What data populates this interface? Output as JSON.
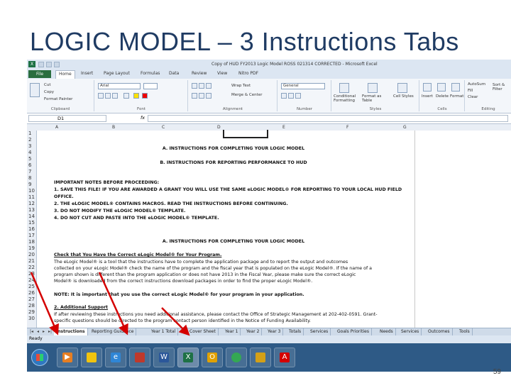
{
  "slide": {
    "title": "LOGIC MODEL – 3 Instructions Tabs",
    "page_number": "59"
  },
  "excel": {
    "window_title": "Copy of HUD FY2013 Logic Model ROSS 021314 CORRECTED - Microsoft Excel",
    "tabs": [
      "File",
      "Home",
      "Insert",
      "Page Layout",
      "Formulas",
      "Data",
      "Review",
      "View",
      "Nitro PDF"
    ],
    "active_tab": "Home",
    "ribbon": {
      "clipboard": {
        "label": "Clipboard",
        "cut": "Cut",
        "copy": "Copy",
        "format_painter": "Format Painter"
      },
      "font": {
        "label": "Font",
        "font_name": "Arial"
      },
      "alignment": {
        "label": "Alignment",
        "wrap_text": "Wrap Text",
        "merge": "Merge & Center"
      },
      "number": {
        "label": "Number",
        "format": "General"
      },
      "styles": {
        "label": "Styles",
        "conditional": "Conditional Formatting",
        "format_table": "Format as Table",
        "cell_styles": "Cell Styles"
      },
      "cells": {
        "label": "Cells",
        "insert": "Insert",
        "delete": "Delete",
        "format": "Format"
      },
      "editing": {
        "label": "Editing",
        "autosum": "AutoSum",
        "fill": "Fill",
        "clear": "Clear",
        "sort": "Sort & Filter",
        "find": "Find & Select"
      }
    },
    "name_box": "D1",
    "fx": "fx",
    "columns": [
      "A",
      "B",
      "C",
      "D",
      "E",
      "F",
      "G"
    ],
    "rows": [
      "1",
      "2",
      "3",
      "4",
      "5",
      "6",
      "7",
      "8",
      "9",
      "10",
      "11",
      "12",
      "13",
      "14",
      "15",
      "16",
      "17",
      "18",
      "19",
      "20",
      "21",
      "22",
      "23",
      "24",
      "25",
      "26",
      "27",
      "28",
      "29",
      "30"
    ],
    "sheet": {
      "heading_a": "A. INSTRUCTIONS FOR COMPLETING YOUR LOGIC MODEL",
      "heading_b": "B. INSTRUCTIONS FOR REPORTING PERFORMANCE TO HUD",
      "important": "IMPORTANT NOTES BEFORE PROCEEDING:",
      "note1": "1. SAVE THIS FILE! IF YOU ARE AWARDED A GRANT YOU WILL USE THE SAME eLOGIC MODEL® FOR REPORTING TO YOUR LOCAL HUD FIELD",
      "note1b": "OFFICE.",
      "note2": "2. THE eLOGIC MODEL® CONTAINS MACROS. READ THE INSTRUCTIONS BEFORE CONTINUING.",
      "note3": "3. DO NOT MODIFY THE eLOGIC MODEL® TEMPLATE.",
      "note4": "4. DO NOT CUT AND PASTE INTO THE eLOGIC MODEL® TEMPLATE.",
      "heading_a2": "A. INSTRUCTIONS FOR COMPLETING YOUR LOGIC MODEL",
      "check": "Check that You Have the Correct eLogic Model® for Your Program.",
      "para1": "The eLogic Model® is a tool that the instructions have to complete the application package and to report the output and outcomes",
      "para2": "collected on your eLogic Model® check the name of the program and the fiscal year that is populated on the eLogic Model®. If the name of a",
      "para3": "program shown is different than the program application or does not have 2013 in the Fiscal Year, please make sure the correct eLogic",
      "para4": "Model® is downloaded from the correct instructions download packages in order to find the proper eLogic Model®.",
      "note_id": "NOTE: It is important that you use the correct eLogic Model® for your program in your application.",
      "support": "2. Additional Support",
      "sup1": "If after reviewing these instructions you need additional assistance, please contact the Office of Strategic Management at 202-402-0591. Grant-",
      "sup2": "specific questions should be directed to the program contact person identified in the Notice of Funding Availability."
    },
    "sheet_tabs": [
      "Instructions",
      "Reporting Guidance",
      "Year 1 Total",
      "Cover Sheet",
      "Year 1",
      "Year 2",
      "Year 3",
      "Totals",
      "Services",
      "Goals Priorities",
      "Needs",
      "Services",
      "Outcomes",
      "Tools"
    ],
    "active_sheet_tab": "Instructions",
    "status": "Ready",
    "taskbar_icons": [
      "windows-start",
      "media-player",
      "file-explorer",
      "internet-explorer",
      "paint",
      "word",
      "excel",
      "outlook",
      "chrome",
      "file-manager",
      "acrobat"
    ],
    "colors": {
      "excel_green": "#1e7145",
      "slide_title": "#1f3b63",
      "arrow_red": "#d40000",
      "taskbar": "#2e5a86"
    }
  }
}
